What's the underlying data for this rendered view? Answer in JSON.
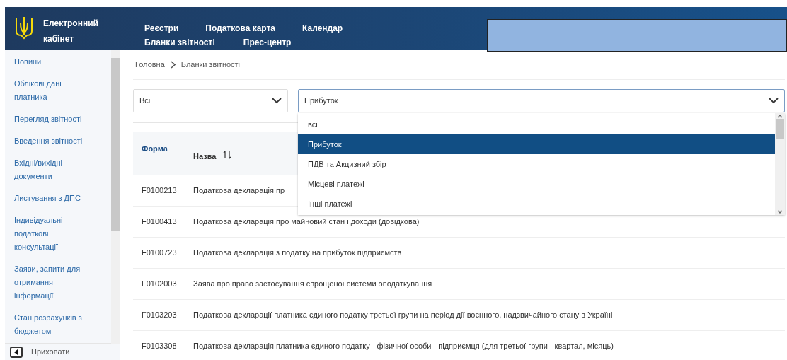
{
  "header": {
    "brand": [
      "Електронний",
      "кабінет"
    ],
    "nav": [
      {
        "label": "Реєстри"
      },
      {
        "label": "Податкова карта"
      },
      {
        "label": "Календар"
      },
      {
        "label": "Бланки звітності"
      },
      {
        "label": "Прес-центр"
      }
    ]
  },
  "sidebar": {
    "items": [
      {
        "label": "Новини"
      },
      {
        "label": "Облікові дані платника"
      },
      {
        "label": "Перегляд звітності"
      },
      {
        "label": "Введення звітності"
      },
      {
        "label": "Вхідні/вихідні документи"
      },
      {
        "label": "Листування з ДПС"
      },
      {
        "label": "Індивідуальні податкові консультації"
      },
      {
        "label": "Заяви, запити для отримання інформації"
      },
      {
        "label": "Стан розрахунків з бюджетом"
      }
    ],
    "hide_button": "Приховати"
  },
  "breadcrumb": [
    "Головна",
    "Бланки звітності"
  ],
  "filters": [
    {
      "value": "Всі",
      "expanded": false
    },
    {
      "value": "Прибуток",
      "expanded": true,
      "options": [
        {
          "label": "всі",
          "selected": false
        },
        {
          "label": "Прибуток",
          "selected": true
        },
        {
          "label": "ПДВ та Акцизний збір",
          "selected": false
        },
        {
          "label": "Місцеві платежі",
          "selected": false
        },
        {
          "label": "Інші платежі",
          "selected": false
        }
      ]
    }
  ],
  "table": {
    "columns": [
      "Форма",
      "Назва"
    ],
    "rows": [
      {
        "form": "F0100213",
        "name": "Податкова декларація пр"
      },
      {
        "form": "F0100413",
        "name": "Податкова декларація про майновий стан і доходи (довідкова)"
      },
      {
        "form": "F0100723",
        "name": "Податкова декларація з податку на прибуток підприємств"
      },
      {
        "form": "F0102003",
        "name": "Заява про право застосування спрощеної системи оподаткування"
      },
      {
        "form": "F0103203",
        "name": "Податкова декларації платника єдиного податку третьої групи на період дії воєнного, надзвичайного стану в Україні"
      },
      {
        "form": "F0103308",
        "name": "Податкова декларація платника єдиного податку - фізичної особи - підприємця (для третьої групи - квартал, місяць)"
      }
    ]
  }
}
